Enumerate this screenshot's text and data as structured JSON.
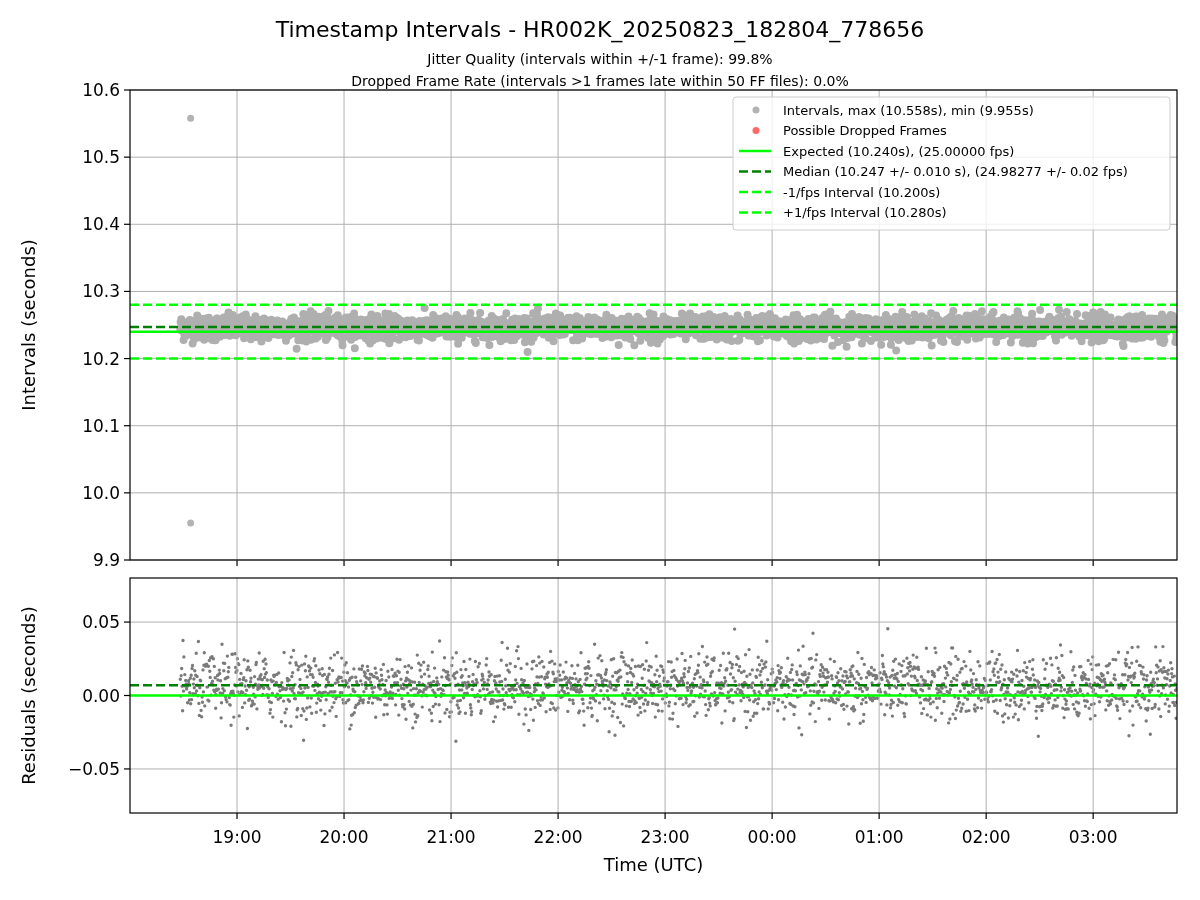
{
  "figure": {
    "title": "Timestamp Intervals - HR002K_20250823_182804_778656",
    "subtitles": [
      "Jitter Quality (intervals within +/-1 frame): 99.8%",
      "Dropped Frame Rate (intervals >1 frames late within 50 FF files): 0.0%"
    ]
  },
  "intervals_plot": {
    "chart_data": {
      "type": "scatter",
      "grid": true,
      "legend": true,
      "ylabel": "Intervals (seconds)",
      "xlim": [
        "2025-08-23T18:00:00Z",
        "2025-08-24T03:47:00Z"
      ],
      "ylim": [
        9.9,
        10.6
      ],
      "yticks": [
        {
          "value": 9.9,
          "label": "9.9"
        },
        {
          "value": 10.0,
          "label": "10.0"
        },
        {
          "value": 10.1,
          "label": "10.1"
        },
        {
          "value": 10.2,
          "label": "10.2"
        },
        {
          "value": 10.3,
          "label": "10.3"
        },
        {
          "value": 10.4,
          "label": "10.4"
        },
        {
          "value": 10.5,
          "label": "10.5"
        },
        {
          "value": 10.6,
          "label": "10.6"
        }
      ],
      "series": [
        {
          "name": "Intervals, max (10.558s), min (9.955s)",
          "color": "#808080",
          "x": [
            "2025-08-23T18:34:00Z",
            "2025-08-23T18:34:00Z"
          ],
          "values": [
            10.558,
            9.955
          ]
        },
        {
          "name": "Possible Dropped Frames",
          "color": "#ff0000"
        }
      ],
      "ref_lines": [
        {
          "axis": "y",
          "value": 10.24,
          "label": "Expected (10.240s), (25.00000 fps)",
          "color": "#00ff00"
        },
        {
          "axis": "y",
          "value": 10.247,
          "label": "Median (10.247 +/- 0.010 s), (24.98277 +/- 0.02 fps)",
          "color": "#008000"
        },
        {
          "axis": "y",
          "value": 10.2,
          "label": "-1/fps Interval (10.200s)",
          "color": "#00ff00"
        },
        {
          "axis": "y",
          "value": 10.28,
          "label": "+1/fps Interval (10.280s)",
          "color": "#00ff00"
        }
      ]
    }
  },
  "residuals_plot": {
    "chart_data": {
      "type": "scatter",
      "grid": true,
      "xlabel": "Time (UTC)",
      "ylabel": "Residuals (seconds)",
      "xlim": [
        "2025-08-23T18:00:00Z",
        "2025-08-24T03:47:00Z"
      ],
      "ylim": [
        -0.08,
        0.08
      ],
      "xticks": [
        {
          "value": "2025-08-23T19:00:00Z",
          "label": "19:00"
        },
        {
          "value": "2025-08-23T20:00:00Z",
          "label": "20:00"
        },
        {
          "value": "2025-08-23T21:00:00Z",
          "label": "21:00"
        },
        {
          "value": "2025-08-23T22:00:00Z",
          "label": "22:00"
        },
        {
          "value": "2025-08-23T23:00:00Z",
          "label": "23:00"
        },
        {
          "value": "2025-08-24T00:00:00Z",
          "label": "00:00"
        },
        {
          "value": "2025-08-24T01:00:00Z",
          "label": "01:00"
        },
        {
          "value": "2025-08-24T02:00:00Z",
          "label": "02:00"
        },
        {
          "value": "2025-08-24T03:00:00Z",
          "label": "03:00"
        }
      ],
      "yticks": [
        {
          "value": -0.05,
          "label": "−0.05"
        },
        {
          "value": 0.0,
          "label": "0.00"
        },
        {
          "value": 0.05,
          "label": "0.05"
        }
      ],
      "ref_lines": [
        {
          "axis": "y",
          "value": 0.007,
          "color": "#008000"
        },
        {
          "axis": "y",
          "value": 0.0,
          "color": "#00ff00"
        }
      ]
    }
  }
}
